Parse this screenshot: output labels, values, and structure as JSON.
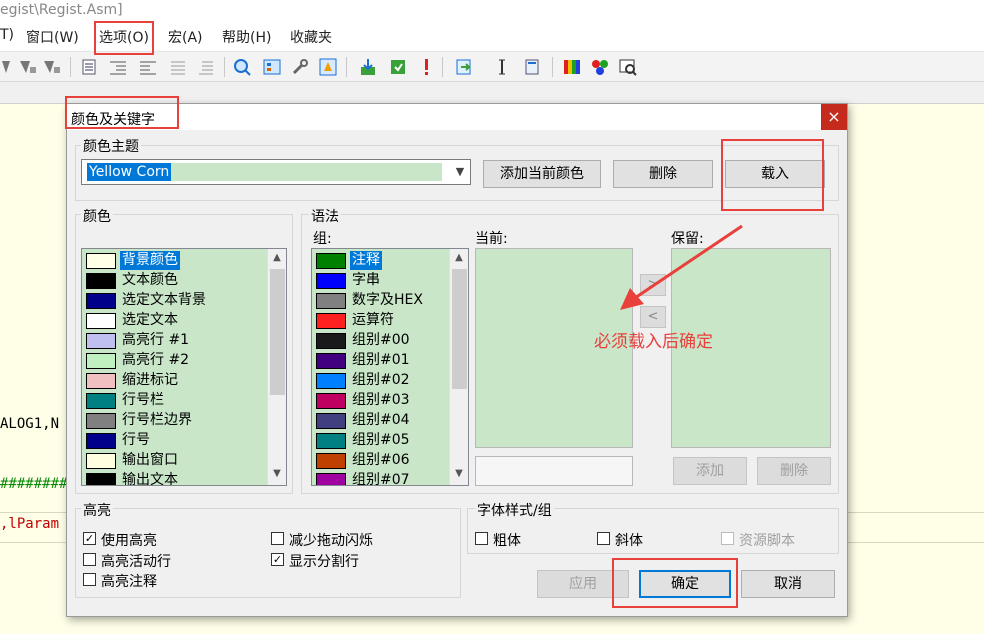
{
  "window": {
    "title_fragment": "egist\\Regist.Asm]"
  },
  "menu": {
    "items": [
      {
        "label": "T)"
      },
      {
        "label": "窗口(W)"
      },
      {
        "label": "选项(O)"
      },
      {
        "label": "宏(A)"
      },
      {
        "label": "帮助(H)"
      },
      {
        "label": "收藏夹"
      }
    ]
  },
  "editor": {
    "line1": "ALOG1,N",
    "line2": "#########",
    "line3": ",lParam"
  },
  "dialog": {
    "title": "颜色及关键字",
    "close": "×",
    "theme": {
      "group_label": "颜色主题",
      "value": "Yellow Corn",
      "add_button": "添加当前颜色",
      "delete_button": "删除",
      "load_button": "载入"
    },
    "colors": {
      "group_label": "颜色",
      "items": [
        {
          "label": "背景颜色",
          "color": "#ffffe8"
        },
        {
          "label": "文本颜色",
          "color": "#000000"
        },
        {
          "label": "选定文本背景",
          "color": "#00008b"
        },
        {
          "label": "选定文本",
          "color": "#ffffff"
        },
        {
          "label": "高亮行 #1",
          "color": "#c0c0f0"
        },
        {
          "label": "高亮行 #2",
          "color": "#c0f0c0"
        },
        {
          "label": "缩进标记",
          "color": "#f0c0c0"
        },
        {
          "label": "行号栏",
          "color": "#008080"
        },
        {
          "label": "行号栏边界",
          "color": "#808080"
        },
        {
          "label": "行号",
          "color": "#00008b"
        },
        {
          "label": "输出窗口",
          "color": "#ffffe0"
        },
        {
          "label": "输出文本",
          "color": "#000000"
        }
      ]
    },
    "syntax": {
      "group_label": "语法",
      "group_list_label": "组:",
      "items": [
        {
          "label": "注释",
          "color": "#008000"
        },
        {
          "label": "字串",
          "color": "#0000ff"
        },
        {
          "label": "数字及HEX",
          "color": "#808080"
        },
        {
          "label": "运算符",
          "color": "#ff2020"
        },
        {
          "label": "组别#00",
          "color": "#1a1a1a"
        },
        {
          "label": "组别#01",
          "color": "#400080"
        },
        {
          "label": "组别#02",
          "color": "#0080ff"
        },
        {
          "label": "组别#03",
          "color": "#c00060"
        },
        {
          "label": "组别#04",
          "color": "#404080"
        },
        {
          "label": "组别#05",
          "color": "#008080"
        },
        {
          "label": "组别#06",
          "color": "#c04000"
        },
        {
          "label": "组别#07",
          "color": "#a000a0"
        }
      ],
      "current_label": "当前:",
      "reserved_label": "保留:",
      "move_right": ">",
      "move_left": "<",
      "add_button": "添加",
      "delete_button": "删除"
    },
    "highlight": {
      "group_label": "高亮",
      "use_highlight": {
        "label": "使用高亮",
        "checked": "✓"
      },
      "highlight_active_line": {
        "label": "高亮活动行",
        "checked": ""
      },
      "highlight_comment": {
        "label": "高亮注释",
        "checked": ""
      },
      "reduce_flicker": {
        "label": "减少拖动闪烁",
        "checked": ""
      },
      "show_splitter": {
        "label": "显示分割行",
        "checked": "✓"
      }
    },
    "font_style": {
      "group_label": "字体样式/组",
      "bold": {
        "label": "粗体",
        "checked": ""
      },
      "italic": {
        "label": "斜体",
        "checked": ""
      },
      "resource_script": {
        "label": "资源脚本",
        "checked": ""
      }
    },
    "buttons": {
      "apply": "应用",
      "ok": "确定",
      "cancel": "取消"
    }
  },
  "annotation": {
    "text": "必须载入后确定",
    "color": "#e8403b"
  }
}
